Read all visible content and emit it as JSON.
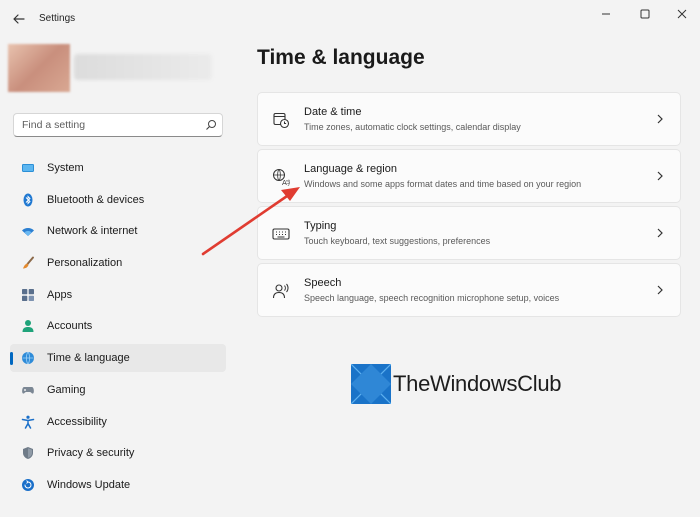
{
  "window": {
    "title": "Settings",
    "controls": [
      "minimize-icon",
      "maximize-icon",
      "close-icon"
    ]
  },
  "search": {
    "placeholder": "Find a setting"
  },
  "sidebar": {
    "items": [
      {
        "label": "System",
        "icon": "display-icon",
        "active": false
      },
      {
        "label": "Bluetooth & devices",
        "icon": "bluetooth-icon",
        "active": false
      },
      {
        "label": "Network & internet",
        "icon": "wifi-icon",
        "active": false
      },
      {
        "label": "Personalization",
        "icon": "brush-icon",
        "active": false
      },
      {
        "label": "Apps",
        "icon": "apps-icon",
        "active": false
      },
      {
        "label": "Accounts",
        "icon": "person-icon",
        "active": false
      },
      {
        "label": "Time & language",
        "icon": "globe-clock-icon",
        "active": true
      },
      {
        "label": "Gaming",
        "icon": "gamepad-icon",
        "active": false
      },
      {
        "label": "Accessibility",
        "icon": "accessibility-icon",
        "active": false
      },
      {
        "label": "Privacy & security",
        "icon": "shield-icon",
        "active": false
      },
      {
        "label": "Windows Update",
        "icon": "update-icon",
        "active": false
      }
    ]
  },
  "main": {
    "title": "Time & language",
    "cards": [
      {
        "title": "Date & time",
        "description": "Time zones, automatic clock settings, calendar display",
        "icon": "calendar-clock-icon"
      },
      {
        "title": "Language & region",
        "description": "Windows and some apps format dates and time based on your region",
        "icon": "language-icon"
      },
      {
        "title": "Typing",
        "description": "Touch keyboard, text suggestions, preferences",
        "icon": "keyboard-icon"
      },
      {
        "title": "Speech",
        "description": "Speech language, speech recognition microphone setup, voices",
        "icon": "speech-icon"
      }
    ]
  },
  "watermark": {
    "text": "TheWindowsClub"
  },
  "colors": {
    "accent": "#0067c0",
    "annotation_arrow": "#e03c31",
    "watermark_logo": "#1a73c8"
  }
}
